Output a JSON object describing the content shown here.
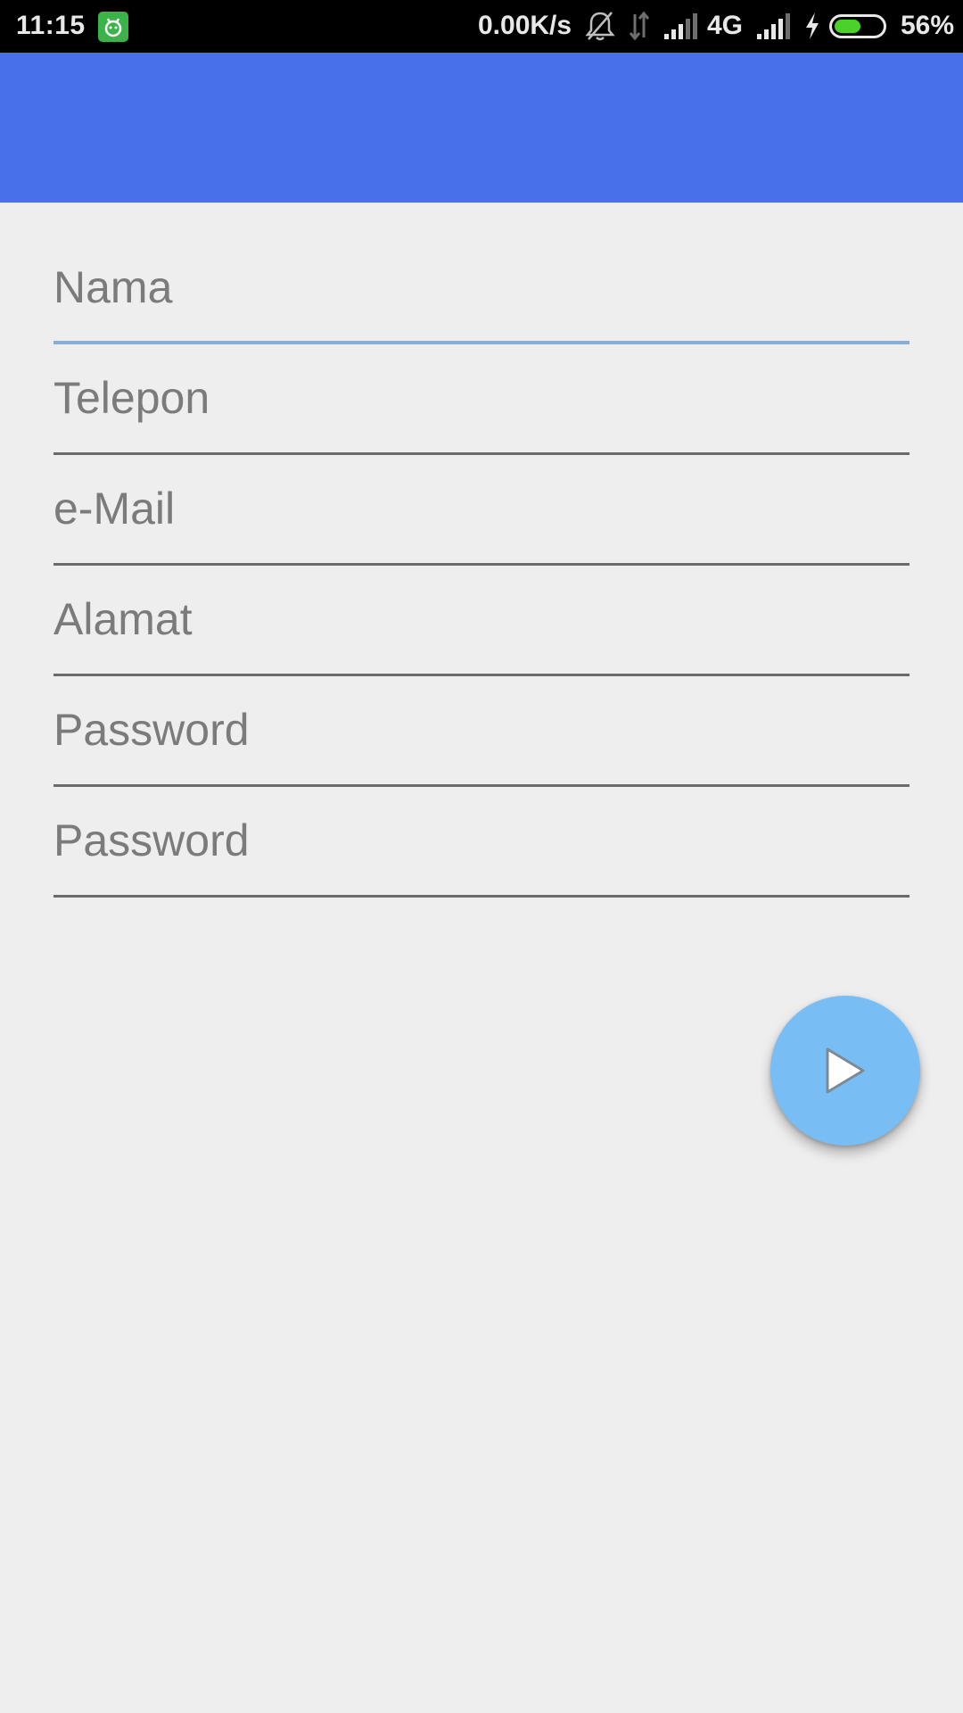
{
  "status_bar": {
    "time": "11:15",
    "network_speed": "0.00K/s",
    "network_type": "4G",
    "battery_percent": "56%",
    "battery_level": 0.56,
    "icons": [
      "app-notification-icon",
      "bell-muted-icon",
      "data-arrows-icon",
      "signal-icon",
      "signal-icon",
      "charging-bolt-icon",
      "battery-icon"
    ]
  },
  "app_bar": {
    "color": "#4871e9"
  },
  "form": {
    "fields": [
      {
        "placeholder": "Nama",
        "value": ""
      },
      {
        "placeholder": "Telepon",
        "value": ""
      },
      {
        "placeholder": "e-Mail",
        "value": ""
      },
      {
        "placeholder": "Alamat",
        "value": ""
      },
      {
        "placeholder": "Password",
        "value": ""
      },
      {
        "placeholder": "Password",
        "value": ""
      }
    ]
  },
  "fab": {
    "icon": "play-arrow-icon",
    "color": "#78bdf3"
  }
}
